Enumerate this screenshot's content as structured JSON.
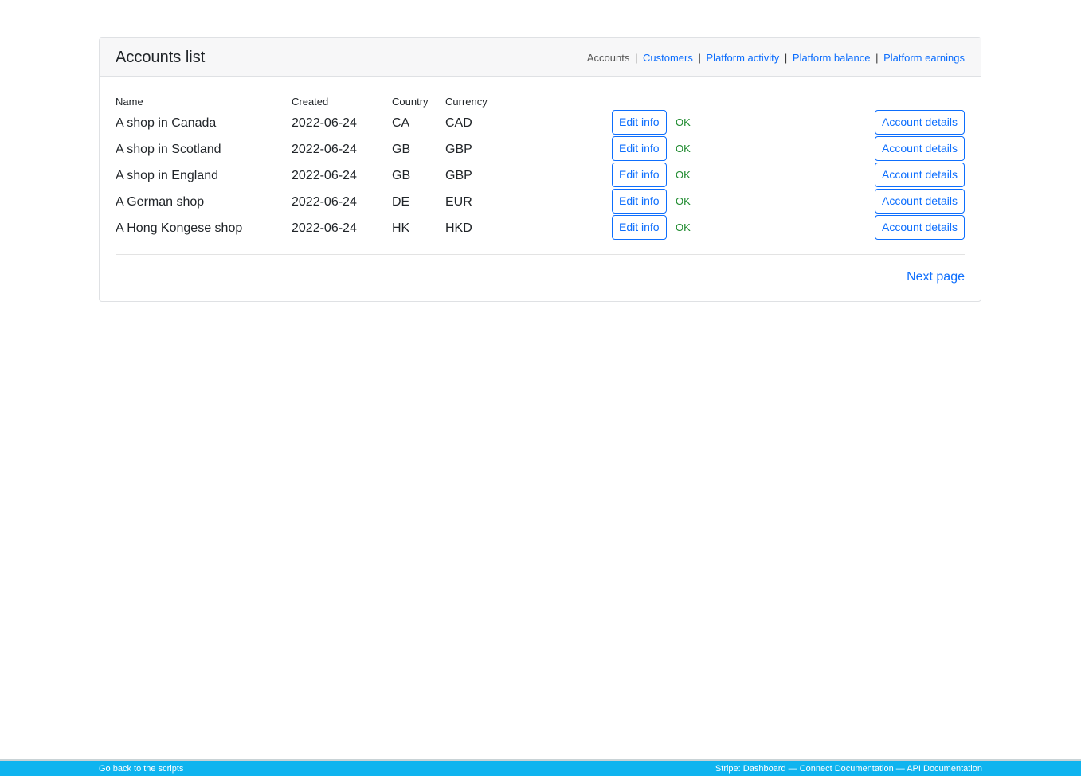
{
  "card": {
    "title": "Accounts list",
    "nav": {
      "current": "Accounts",
      "links": [
        "Customers",
        "Platform activity",
        "Platform balance",
        "Platform earnings"
      ],
      "separator": "|"
    }
  },
  "table": {
    "headers": [
      "Name",
      "Created",
      "Country",
      "Currency"
    ],
    "rows": [
      {
        "name": "A shop in Canada",
        "created": "2022-06-24",
        "country": "CA",
        "currency": "CAD",
        "edit": "Edit info",
        "status": "OK",
        "details": "Account details"
      },
      {
        "name": "A shop in Scotland",
        "created": "2022-06-24",
        "country": "GB",
        "currency": "GBP",
        "edit": "Edit info",
        "status": "OK",
        "details": "Account details"
      },
      {
        "name": "A shop in England",
        "created": "2022-06-24",
        "country": "GB",
        "currency": "GBP",
        "edit": "Edit info",
        "status": "OK",
        "details": "Account details"
      },
      {
        "name": "A German shop",
        "created": "2022-06-24",
        "country": "DE",
        "currency": "EUR",
        "edit": "Edit info",
        "status": "OK",
        "details": "Account details"
      },
      {
        "name": "A Hong Kongese shop",
        "created": "2022-06-24",
        "country": "HK",
        "currency": "HKD",
        "edit": "Edit info",
        "status": "OK",
        "details": "Account details"
      }
    ]
  },
  "pagination": {
    "next": "Next page"
  },
  "footer": {
    "left": "Go back to the scripts",
    "right": "Stripe: Dashboard — Connect Documentation — API Documentation"
  }
}
